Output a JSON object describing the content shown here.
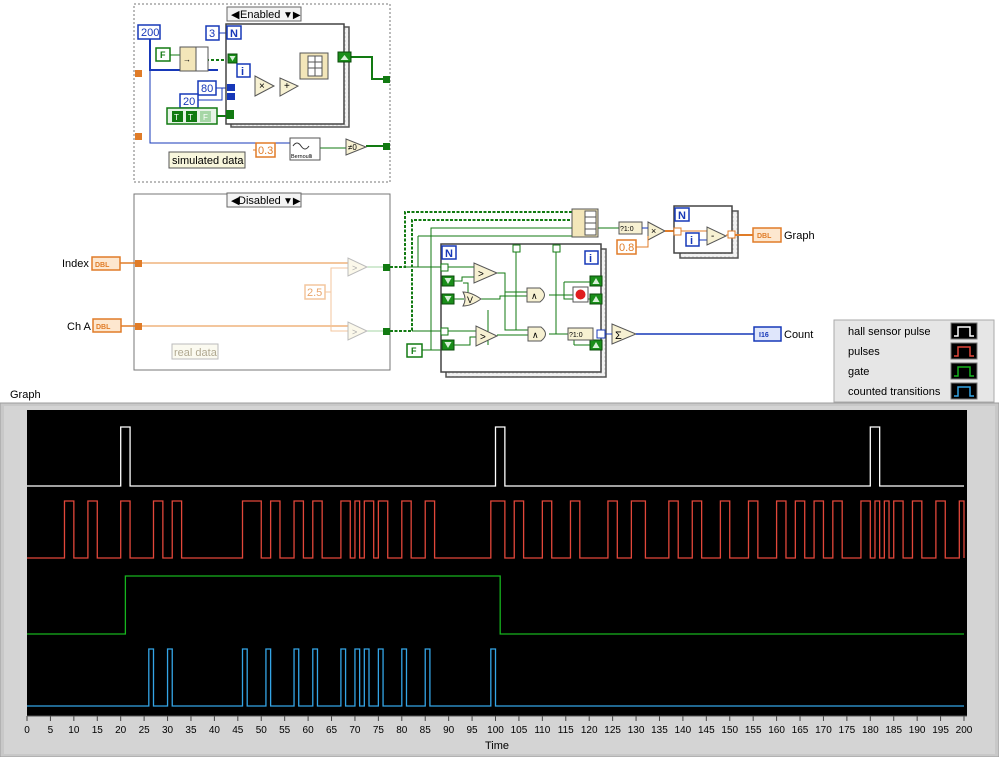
{
  "diagram": {
    "case_top": {
      "selector": "Enabled",
      "label": "simulated data"
    },
    "case_bottom": {
      "selector": "Disabled",
      "label": "real data"
    },
    "constants": {
      "n200": "200",
      "n3": "3",
      "n80": "80",
      "n20": "20",
      "n03": "0.3",
      "n25": "2.5",
      "n08": "0.8",
      "f_top": "F",
      "f_bottom": "F",
      "bool_t1": "T",
      "bool_t2": "T",
      "bool_f": "F"
    },
    "terminals": {
      "index": "Index",
      "ch_a": "Ch A",
      "dbl": "DBL",
      "graph_out": "Graph",
      "count_out": "Count",
      "i16": "I16"
    },
    "loop_labels": {
      "n": "N",
      "i": "i"
    },
    "node_labels": {
      "bernoulli": "Bernoulli",
      "convert": "?1:0",
      "ne0": "≠0",
      "sum": "Σ"
    }
  },
  "graph": {
    "title": "Graph",
    "x_label": "Time",
    "colors": {
      "bg": "#000000",
      "hall sensor pulse": "#ffffff",
      "pulses": "#e2473a",
      "gate": "#16b41e",
      "counted transitions": "#34a5e6"
    },
    "legend": [
      "hall sensor pulse",
      "pulses",
      "gate",
      "counted transitions"
    ]
  },
  "chart_data": {
    "type": "line",
    "xlabel": "Time",
    "xlim": [
      0,
      200
    ],
    "x_ticks": [
      0,
      5,
      10,
      15,
      20,
      25,
      30,
      35,
      40,
      45,
      50,
      55,
      60,
      65,
      70,
      75,
      80,
      85,
      90,
      95,
      100,
      105,
      110,
      115,
      120,
      125,
      130,
      135,
      140,
      145,
      150,
      155,
      160,
      165,
      170,
      175,
      180,
      185,
      190,
      195,
      200
    ],
    "series": [
      {
        "name": "hall sensor pulse",
        "high_intervals": [
          [
            20,
            22
          ],
          [
            100,
            102
          ],
          [
            180,
            182
          ]
        ]
      },
      {
        "name": "pulses",
        "high_intervals": [
          [
            8,
            10
          ],
          [
            13,
            15
          ],
          [
            20,
            22
          ],
          [
            27,
            29
          ],
          [
            31,
            33
          ],
          [
            46,
            50
          ],
          [
            52,
            54
          ],
          [
            57,
            59
          ],
          [
            61,
            63
          ],
          [
            67,
            69
          ],
          [
            70,
            71
          ],
          [
            72,
            74
          ],
          [
            75,
            77
          ],
          [
            80,
            82
          ],
          [
            85,
            87
          ],
          [
            99,
            102
          ],
          [
            104,
            106
          ],
          [
            110,
            112
          ],
          [
            116,
            118
          ],
          [
            124,
            126
          ],
          [
            129,
            132
          ],
          [
            137,
            139
          ],
          [
            142,
            144
          ],
          [
            148,
            150
          ],
          [
            154,
            156
          ],
          [
            160,
            162
          ],
          [
            164,
            166
          ],
          [
            168,
            170
          ],
          [
            172,
            174
          ],
          [
            178,
            180
          ],
          [
            181,
            182
          ],
          [
            183,
            184
          ],
          [
            185,
            187
          ],
          [
            189,
            191
          ],
          [
            194,
            196
          ],
          [
            199,
            200
          ]
        ]
      },
      {
        "name": "gate",
        "high_intervals": [
          [
            21,
            101
          ]
        ]
      },
      {
        "name": "counted transitions",
        "high_intervals": [
          [
            26,
            27
          ],
          [
            30,
            31
          ],
          [
            46,
            47
          ],
          [
            51,
            52
          ],
          [
            57,
            58
          ],
          [
            61,
            62
          ],
          [
            67,
            68
          ],
          [
            70,
            71
          ],
          [
            72,
            73
          ],
          [
            75,
            76
          ],
          [
            80,
            81
          ],
          [
            85,
            86
          ],
          [
            99,
            100
          ]
        ]
      }
    ]
  }
}
